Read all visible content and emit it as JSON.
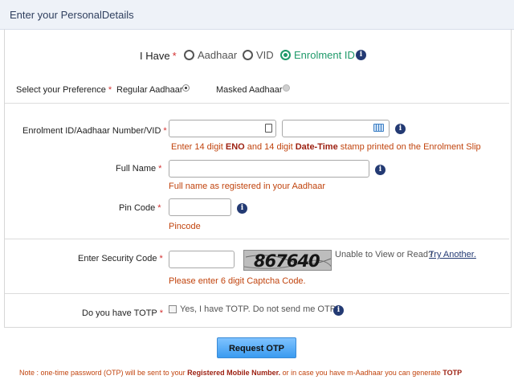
{
  "header": {
    "title": "Enter your PersonalDetails"
  },
  "have": {
    "label": "I Have",
    "options": [
      {
        "label": "Aadhaar",
        "selected": false
      },
      {
        "label": "VID",
        "selected": false
      },
      {
        "label": "Enrolment ID",
        "selected": true
      }
    ]
  },
  "preference": {
    "label": "Select your Preference",
    "options": [
      {
        "label": "Regular Aadhaar",
        "selected": true
      },
      {
        "label": "Masked Aadhaar",
        "selected": false
      }
    ]
  },
  "enrolment": {
    "label": "Enrolment ID/Aadhaar Number/VID",
    "hint_pre": "Enter 14 digit ",
    "hint_b1": "ENO",
    "hint_mid": " and 14 digit ",
    "hint_b2": "Date-Time",
    "hint_post": " stamp printed on the Enrolment Slip"
  },
  "fullname": {
    "label": "Full Name",
    "hint": "Full name as registered in your Aadhaar"
  },
  "pincode": {
    "label": "Pin Code",
    "hint": "Pincode"
  },
  "security": {
    "label": "Enter Security Code",
    "captcha_text": "867640",
    "unable_text": "Unable to View or Read?",
    "try_another": "Try Another.",
    "hint": "Please enter 6 digit Captcha Code."
  },
  "totp": {
    "label": "Do you have TOTP",
    "checkbox_label": "Yes, I have TOTP. Do not send me OTP.",
    "checked": false
  },
  "request_button": "Request OTP",
  "note": {
    "pre": "Note : one-time password (OTP) will be sent to your ",
    "b1": "Registered Mobile Number.",
    "mid": " or in case you have m-Aadhaar you can generate ",
    "b2": "TOTP"
  },
  "colors": {
    "accent_green": "#1f9a6a",
    "hint_orange": "#c1440e",
    "button_blue": "#3a9bf0",
    "info_navy": "#233a73"
  }
}
